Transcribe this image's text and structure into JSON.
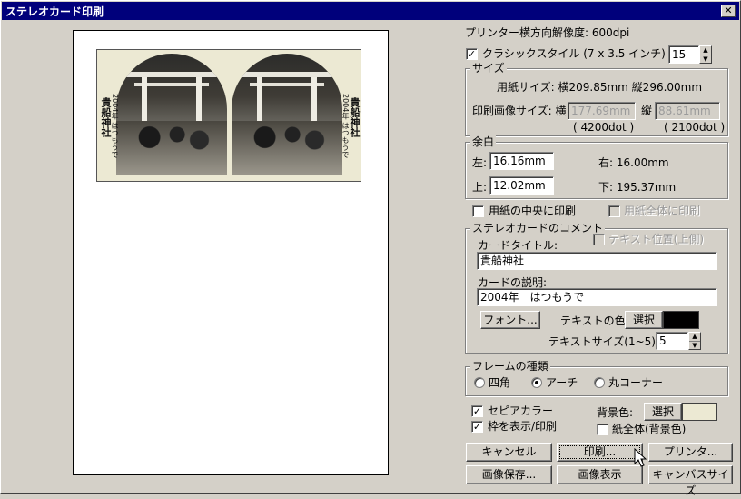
{
  "window": {
    "title": "ステレオカード印刷",
    "close_label": "✕"
  },
  "preview": {
    "card_title": "貴船神社",
    "card_description": "2004年 はつもうで"
  },
  "printer_resolution": "プリンター横方向解像度: 600dpi",
  "classic_style": {
    "label": "クラシックスタイル (7 x 3.5 インチ)",
    "checked": true,
    "value": "15"
  },
  "size_group": {
    "label": "サイズ",
    "paper_size": "用紙サイズ: 横209.85mm 縦296.00mm",
    "print_image_size_label": "印刷画像サイズ: 横",
    "width_value": "177.69mm",
    "height_label": "縦",
    "height_value": "88.61mm",
    "width_dots": "( 4200dot )",
    "height_dots": "( 2100dot )"
  },
  "margin_group": {
    "label": "余白",
    "left_label": "左:",
    "left_value": "16.16mm",
    "right_text": "右: 16.00mm",
    "top_label": "上:",
    "top_value": "12.02mm",
    "bottom_text": "下: 195.37mm"
  },
  "center_print": {
    "label": "用紙の中央に印刷",
    "checked": false
  },
  "full_paper_print": {
    "label": "用紙全体に印刷",
    "checked": false
  },
  "comment_group": {
    "label": "ステレオカードのコメント",
    "text_position_label": "テキスト位置(上側)",
    "card_title_label": "カードタイトル:",
    "card_title_value": "貴船神社",
    "card_desc_label": "カードの説明:",
    "card_desc_value": "2004年　はつもうで",
    "font_button": "フォント...",
    "text_color_label": "テキストの色:",
    "text_color_select": "選択",
    "text_color": "#000000",
    "text_size_label": "テキストサイズ(1~5):",
    "text_size_value": "5"
  },
  "frame_group": {
    "label": "フレームの種類",
    "options": [
      "四角",
      "アーチ",
      "丸コーナー"
    ],
    "selected": "アーチ"
  },
  "sepia": {
    "label": "セピアカラー",
    "checked": true
  },
  "show_frame": {
    "label": "枠を表示/印刷",
    "checked": true
  },
  "background": {
    "label": "背景色:",
    "select": "選択",
    "color": "#ece9d3",
    "whole_paper_label": "紙全体(背景色)",
    "whole_paper_checked": false
  },
  "buttons": {
    "cancel": "キャンセル",
    "print": "印刷...",
    "printer": "プリンタ...",
    "save_image": "画像保存...",
    "show_image": "画像表示",
    "canvas_size": "キャンバスサイズ"
  }
}
